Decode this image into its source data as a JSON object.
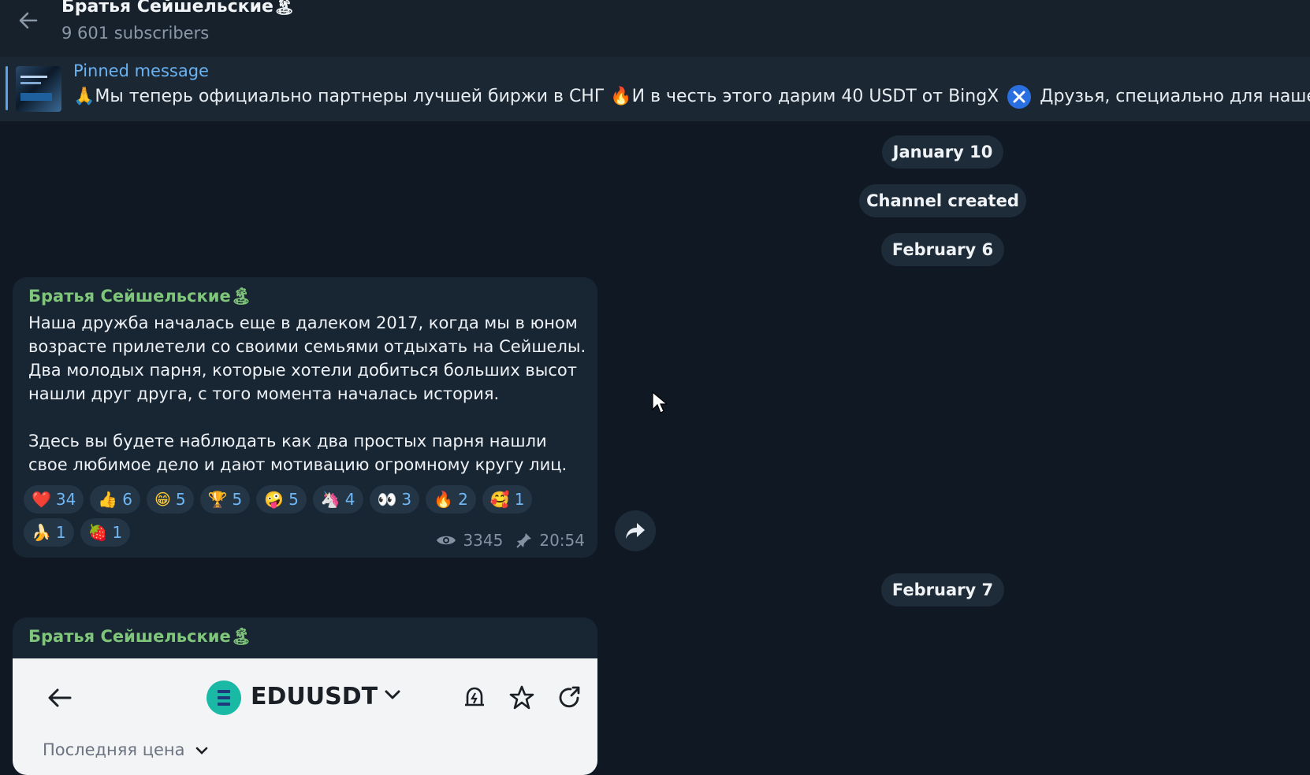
{
  "header": {
    "title": "Братья Сейшельские🏝",
    "subscribers": "9 601 subscribers"
  },
  "pinned": {
    "label": "Pinned message",
    "text_part1": "🙏Мы теперь официально партнеры лучшей биржи в СНГ 🔥И в честь этого дарим 40 USDT от BingX",
    "text_part2": "Друзья, специально для нашего ка"
  },
  "dates": {
    "date1": "January 10",
    "service": "Channel created",
    "date2": "February 6",
    "date3": "February 7"
  },
  "message1": {
    "author": "Братья Сейшельские🏝",
    "paragraph1": "Наша дружба началась еще в далеком 2017, когда мы в юном возрасте прилетели со своими семьями отдыхать на Сейшелы. Два молодых парня, которые хотели добиться больших высот нашли друг друга, с того момента началась история.",
    "paragraph2": "Здесь вы будете наблюдать как два простых парня нашли свое любимое дело и дают мотивацию огромному кругу лиц.",
    "reactions": [
      {
        "emoji": "❤️",
        "count": "34"
      },
      {
        "emoji": "👍",
        "count": "6"
      },
      {
        "emoji": "😁",
        "count": "5"
      },
      {
        "emoji": "🏆",
        "count": "5"
      },
      {
        "emoji": "🤪",
        "count": "5"
      },
      {
        "emoji": "🦄",
        "count": "4"
      },
      {
        "emoji": "👀",
        "count": "3"
      },
      {
        "emoji": "🔥",
        "count": "2"
      },
      {
        "emoji": "🥰",
        "count": "1"
      },
      {
        "emoji": "🍌",
        "count": "1"
      },
      {
        "emoji": "🍓",
        "count": "1"
      }
    ],
    "views": "3345",
    "time": "20:54"
  },
  "message2": {
    "author": "Братья Сейшельские🏝",
    "embed": {
      "pair": "EDUUSDT",
      "last_price_label": "Последняя цена"
    }
  },
  "colors": {
    "background": "#0f1823",
    "header": "#17212b",
    "bubble": "#182533",
    "author": "#7fc57a",
    "link": "#6ab3f3"
  }
}
